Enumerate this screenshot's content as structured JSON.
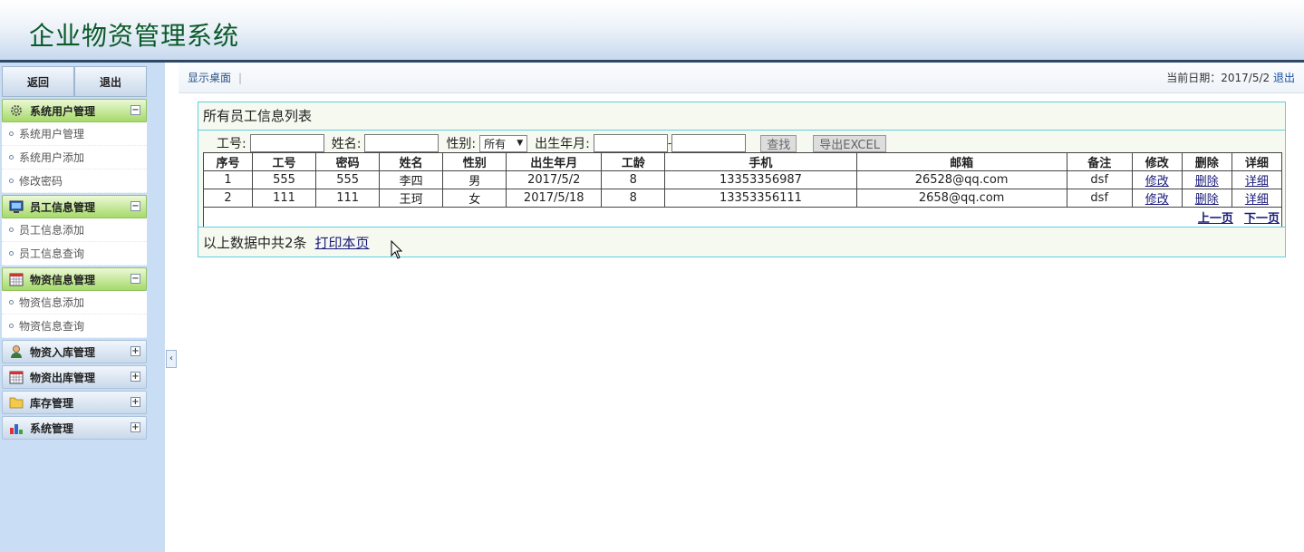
{
  "header": {
    "title": "企业物资管理系统"
  },
  "sidebar": {
    "back_label": "返回",
    "exit_label": "退出",
    "groups": [
      {
        "label": "系统用户管理",
        "icon": "gear-icon",
        "open": true,
        "items": [
          "系统用户管理",
          "系统用户添加",
          "修改密码"
        ]
      },
      {
        "label": "员工信息管理",
        "icon": "monitor-icon",
        "open": true,
        "items": [
          "员工信息添加",
          "员工信息查询"
        ]
      },
      {
        "label": "物资信息管理",
        "icon": "calendar-icon",
        "open": true,
        "items": [
          "物资信息添加",
          "物资信息查询"
        ]
      },
      {
        "label": "物资入库管理",
        "icon": "user-icon",
        "open": false,
        "items": []
      },
      {
        "label": "物资出库管理",
        "icon": "calendar-icon",
        "open": false,
        "items": []
      },
      {
        "label": "库存管理",
        "icon": "folder-icon",
        "open": false,
        "items": []
      },
      {
        "label": "系统管理",
        "icon": "chart-icon",
        "open": false,
        "items": []
      }
    ]
  },
  "topbar": {
    "desktop_label": "显示桌面",
    "separator": "|",
    "date_text": "当前日期：2017/5/2",
    "logout_label": "退出"
  },
  "panel": {
    "title": "所有员工信息列表",
    "search": {
      "id_label": "工号:",
      "name_label": "姓名:",
      "gender_label": "性别:",
      "gender_value": "所有",
      "birth_label": "出生年月:",
      "range_sep": "-",
      "find_label": "查找",
      "export_label": "导出EXCEL"
    },
    "columns": [
      "序号",
      "工号",
      "密码",
      "姓名",
      "性别",
      "出生年月",
      "工龄",
      "手机",
      "邮箱",
      "备注",
      "修改",
      "删除",
      "详细"
    ],
    "rows": [
      {
        "no": "1",
        "id": "555",
        "pwd": "555",
        "name": "李四",
        "gender": "男",
        "birth": "2017/5/2",
        "years": "8",
        "phone": "13353356987",
        "email": "26528@qq.com",
        "note": "dsf",
        "edit": "修改",
        "del": "删除",
        "detail": "详细"
      },
      {
        "no": "2",
        "id": "111",
        "pwd": "111",
        "name": "王珂",
        "gender": "女",
        "birth": "2017/5/18",
        "years": "8",
        "phone": "13353356111",
        "email": "2658@qq.com",
        "note": "dsf",
        "edit": "修改",
        "del": "删除",
        "detail": "详细"
      }
    ],
    "pager": {
      "prev": "上一页",
      "next": "下一页"
    },
    "footer_text": "以上数据中共2条",
    "print_label": "打印本页"
  }
}
